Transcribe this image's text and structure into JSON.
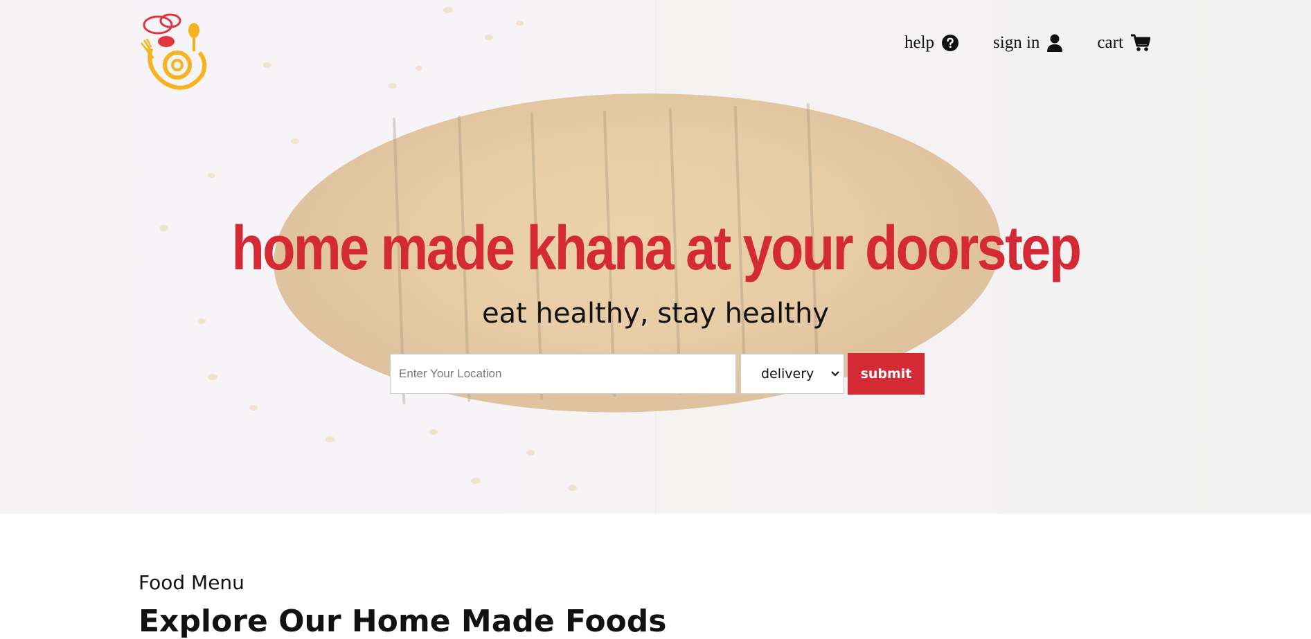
{
  "header": {
    "logo_alt": "chef logo",
    "nav": [
      {
        "label": "help",
        "icon": "question-circle-icon"
      },
      {
        "label": "sign in",
        "icon": "user-icon"
      },
      {
        "label": "cart",
        "icon": "cart-icon"
      }
    ]
  },
  "hero": {
    "headline": "home made khana at your doorstep",
    "subline": "eat healthy, stay healthy",
    "location_placeholder": "Enter Your Location",
    "location_value": "",
    "mode_selected": "delivery",
    "submit_label": "submit",
    "accent_color": "#d32a35"
  },
  "menu": {
    "eyebrow": "Food Menu",
    "title": "Explore Our Home Made Foods"
  }
}
